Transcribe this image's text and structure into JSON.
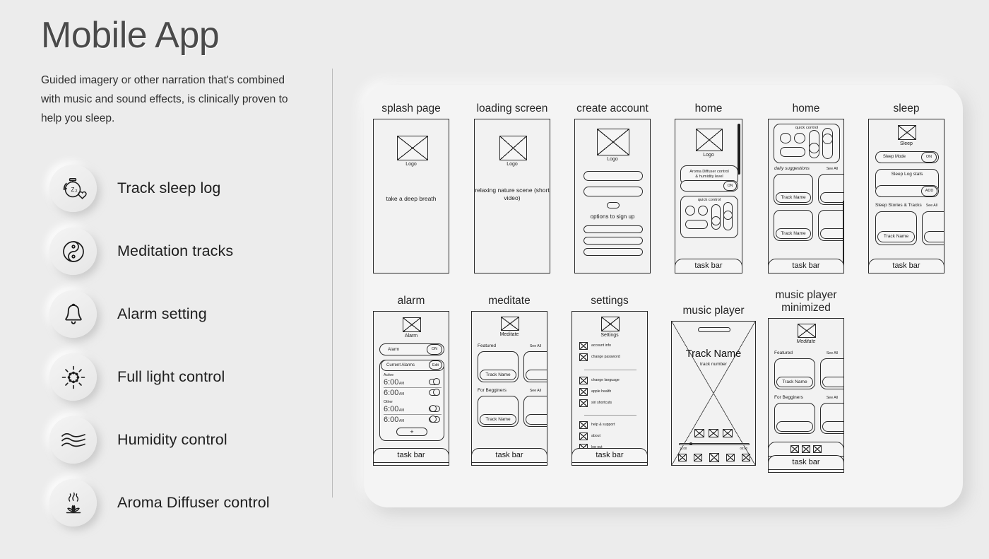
{
  "page": {
    "title": "Mobile App",
    "intro": "Guided imagery or other narration that's combined with music and sound effects, is clinically proven to help you sleep."
  },
  "features": [
    {
      "icon": "sleep-timer-icon",
      "label": "Track sleep log"
    },
    {
      "icon": "yin-yang-icon",
      "label": "Meditation tracks"
    },
    {
      "icon": "bell-icon",
      "label": "Alarm setting"
    },
    {
      "icon": "sun-icon",
      "label": "Full light control"
    },
    {
      "icon": "waves-icon",
      "label": "Humidity control"
    },
    {
      "icon": "lotus-diffuser-icon",
      "label": "Aroma Diffuser control"
    }
  ],
  "common": {
    "logo_caption": "Logo",
    "task_bar": "task bar",
    "see_all": "See All",
    "track_name": "Track Name",
    "on": "ON"
  },
  "screens": {
    "splash": {
      "caption": "splash page",
      "logo": "Logo",
      "body": "take a deep breath"
    },
    "loading": {
      "caption": "loading screen",
      "logo": "Logo",
      "body": "relaxing nature\nscene\n(short video)"
    },
    "create_account": {
      "caption": "create account",
      "logo": "Logo",
      "options_label": "options to sign up"
    },
    "home_a": {
      "caption": "home",
      "logo": "Logo",
      "aroma_label": "Aroma Diffuser control\n& humidity level",
      "aroma_toggle": "ON",
      "quick_control": "quick control",
      "task_bar": "task bar"
    },
    "home_b": {
      "caption": "home",
      "quick_control": "quick control",
      "daily_suggestions": "daily suggestions",
      "see_all": "See All",
      "track_1": "Track Name",
      "track_2": "Track Name",
      "task_bar": "task bar"
    },
    "sleep": {
      "caption": "sleep",
      "logo": "Sleep",
      "sleep_mode": "Sleep Mode",
      "sleep_mode_toggle": "ON",
      "sleep_log_stats": "Sleep Log stats",
      "add_button": "ADD",
      "stories_label": "Sleep Stories & Tracks",
      "see_all": "See All",
      "track_1": "Track Name",
      "task_bar": "task bar"
    },
    "alarm": {
      "caption": "alarm",
      "logo": "Alarm",
      "alarm_row": "Alarm",
      "alarm_toggle": "ON",
      "current_alarms": "Current Alarms",
      "edit": "Edit",
      "group_active": "Active",
      "group_other": "Other",
      "times": [
        {
          "time": "6:00",
          "suffix": "AM",
          "on": true
        },
        {
          "time": "6:00",
          "suffix": "AM",
          "on": true
        },
        {
          "time": "6:00",
          "suffix": "AM",
          "on": false
        },
        {
          "time": "6:00",
          "suffix": "AM",
          "on": false
        }
      ],
      "add_symbol": "+",
      "task_bar": "task bar"
    },
    "meditate": {
      "caption": "meditate",
      "logo": "Meditate",
      "featured": "Featured",
      "featured_see_all": "See All",
      "featured_track": "Track Name",
      "beginners": "For Begginers",
      "beginners_see_all": "See All",
      "beginners_track": "Track Name",
      "task_bar": "task bar"
    },
    "settings": {
      "caption": "settings",
      "logo": "Settings",
      "groups": [
        [
          "account info",
          "change password"
        ],
        [
          "change language",
          "apple health",
          "siri shortcuts"
        ],
        [
          "help & support",
          "about",
          "log out"
        ]
      ],
      "task_bar": "task bar"
    },
    "music_player": {
      "caption": "music player",
      "track_name": "Track Name",
      "track_number": "track number",
      "time_elapsed": "11:00",
      "time_total": "00:00"
    },
    "music_player_min": {
      "caption": "music player\nminimized",
      "logo": "Meditate",
      "featured": "Featured",
      "featured_see_all": "See All",
      "featured_track": "Track Name",
      "beginners": "For Begginers",
      "beginners_see_all": "See All",
      "task_bar": "task bar"
    }
  }
}
